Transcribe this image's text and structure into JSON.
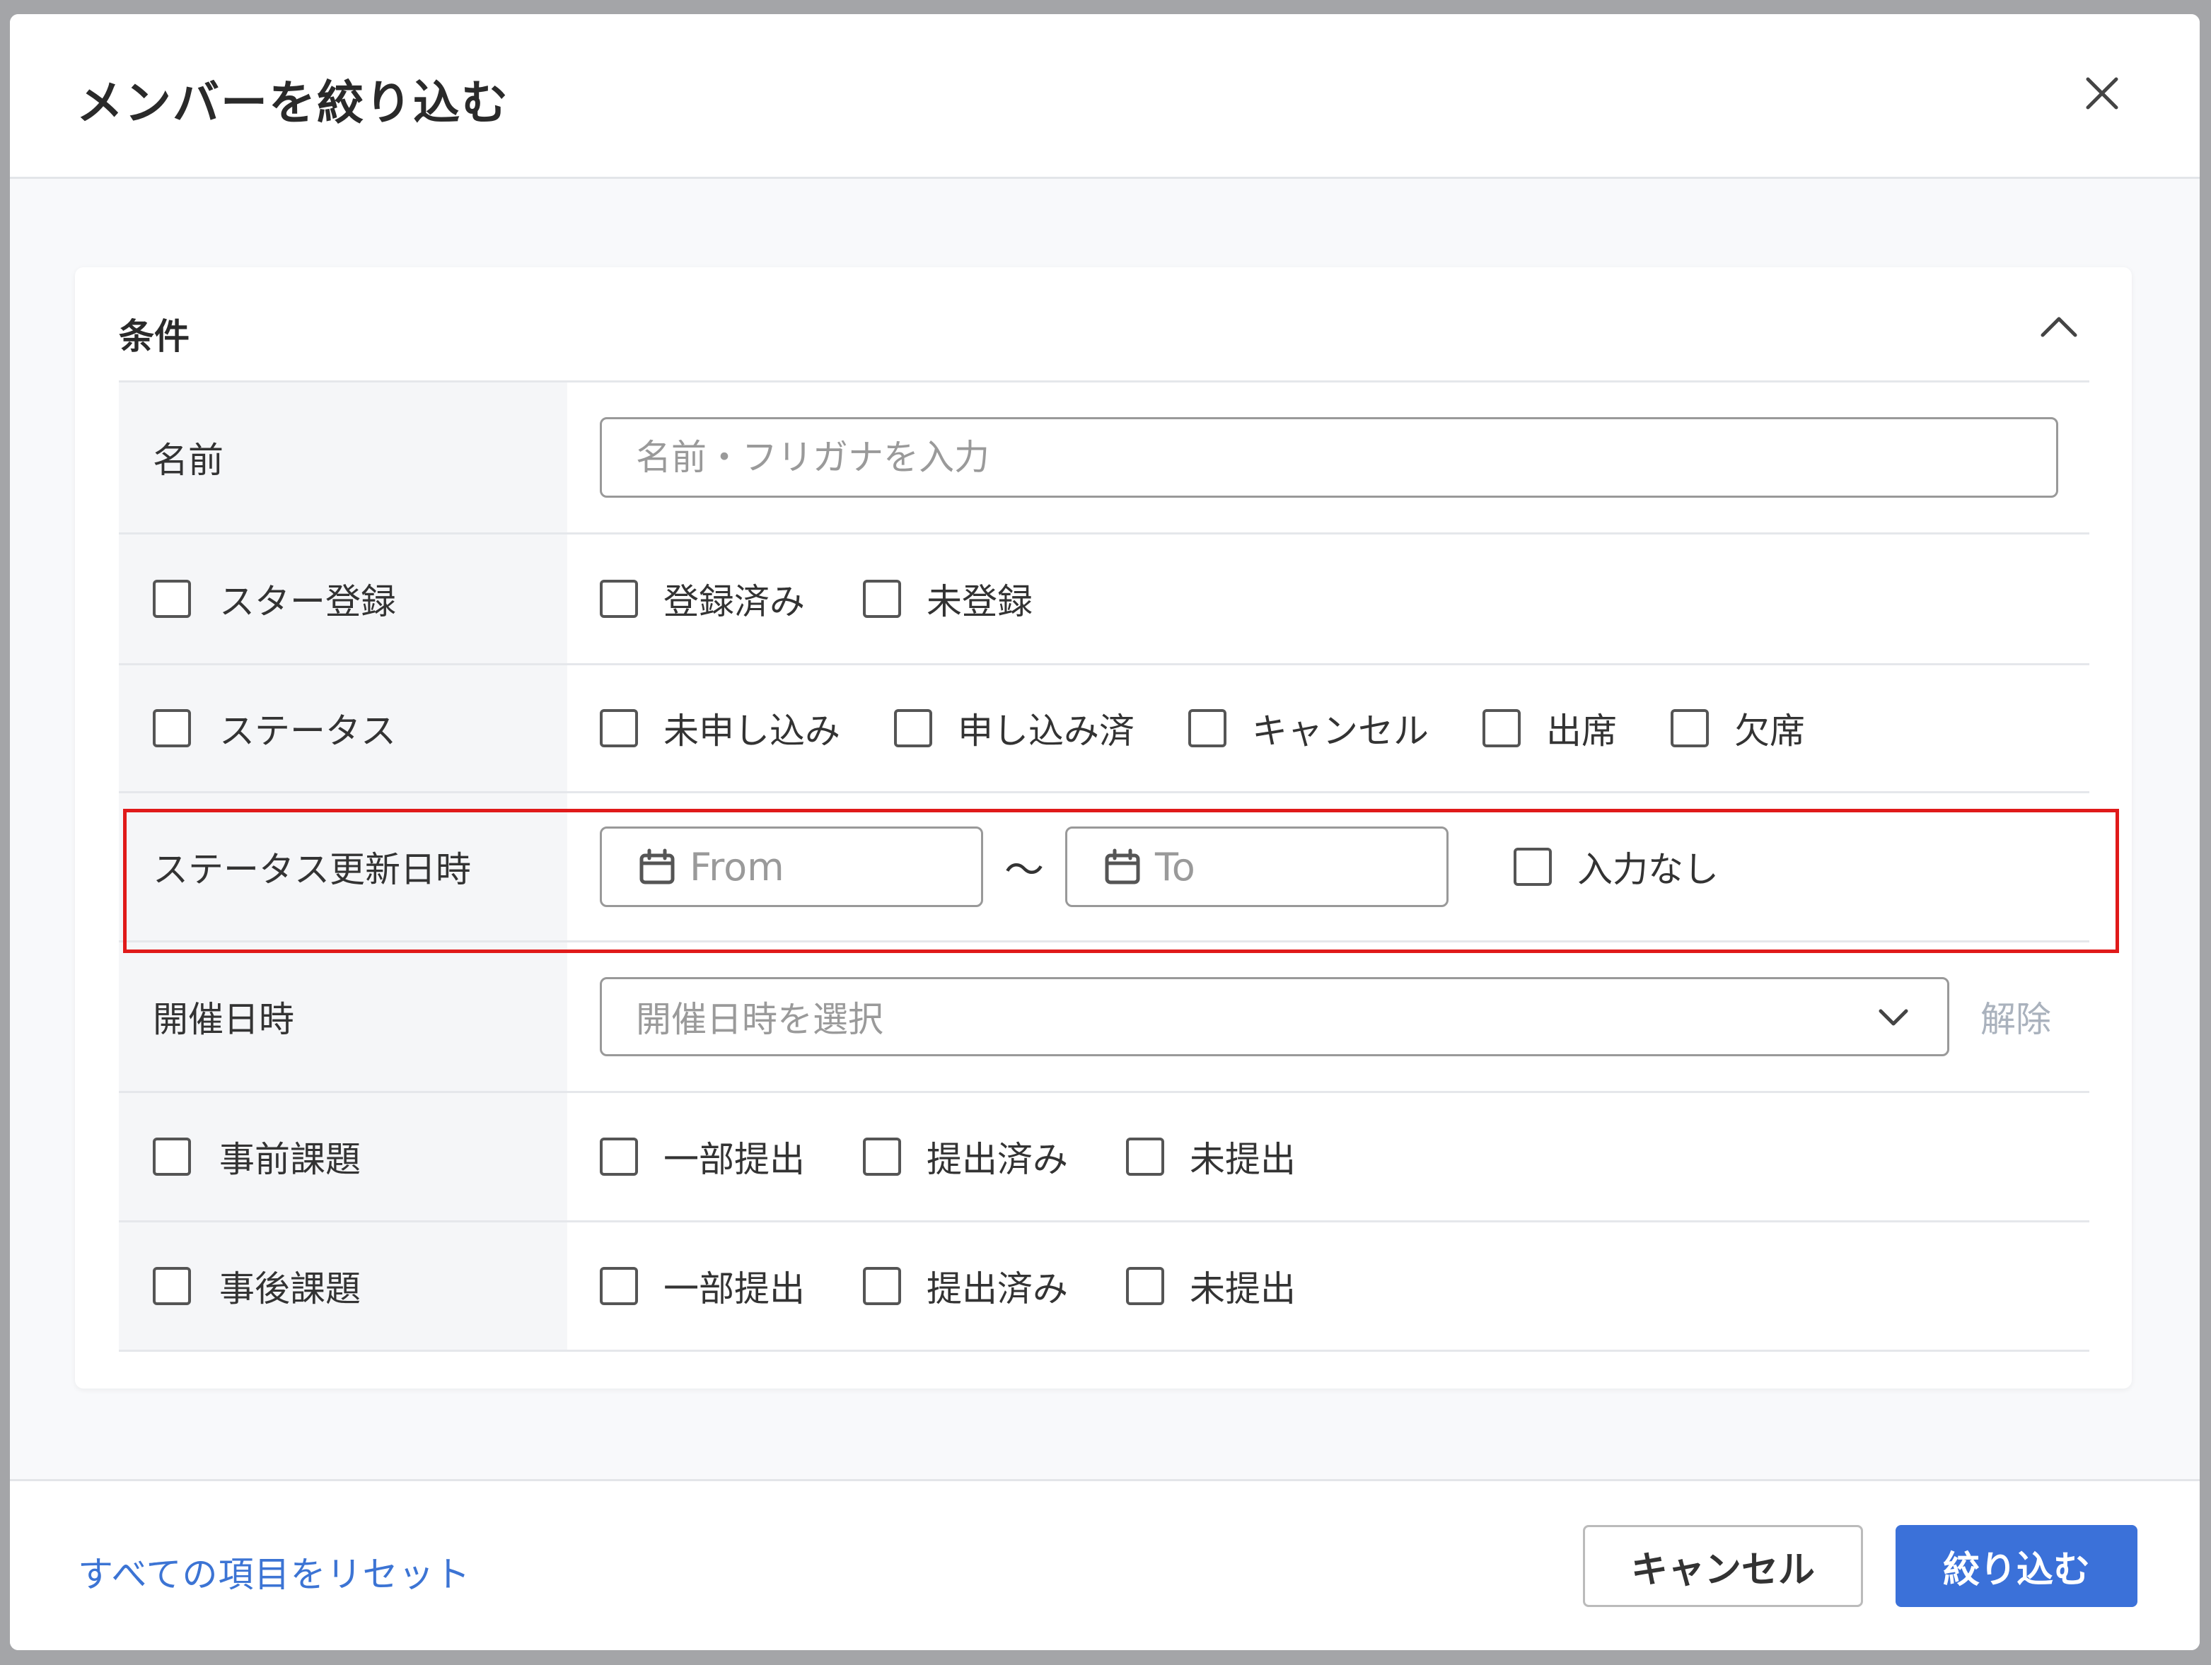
{
  "dialog": {
    "title": "メンバーを絞り込む"
  },
  "conditions": {
    "title": "条件",
    "name": {
      "label": "名前",
      "placeholder": "名前・フリガナを入力"
    },
    "star": {
      "label": "スター登録",
      "options": [
        "登録済み",
        "未登録"
      ]
    },
    "status": {
      "label": "ステータス",
      "options": [
        "未申し込み",
        "申し込み済",
        "キャンセル",
        "出席",
        "欠席"
      ]
    },
    "status_updated": {
      "label": "ステータス更新日時",
      "from": "From",
      "to": "To",
      "separator": "〜",
      "empty_option": "入力なし"
    },
    "event_date": {
      "label": "開催日時",
      "placeholder": "開催日時を選択",
      "clear": "解除"
    },
    "pre_task": {
      "label": "事前課題",
      "options": [
        "一部提出",
        "提出済み",
        "未提出"
      ]
    },
    "post_task": {
      "label": "事後課題",
      "options": [
        "一部提出",
        "提出済み",
        "未提出"
      ]
    }
  },
  "footer": {
    "reset": "すべての項目をリセット",
    "cancel": "キャンセル",
    "apply": "絞り込む"
  },
  "colors": {
    "primary": "#3b71d9",
    "link": "#3c74d4",
    "highlight": "#e01a1a"
  }
}
